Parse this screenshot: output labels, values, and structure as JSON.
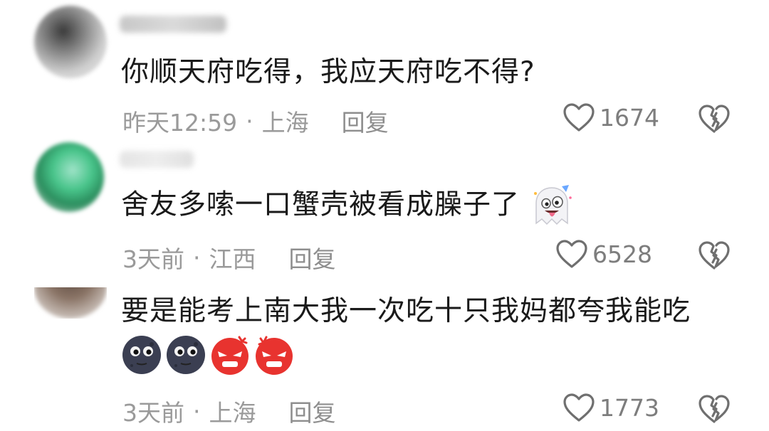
{
  "comments": [
    {
      "text": "你顺天府吃得，我应天府吃不得?",
      "time": "昨天12:59",
      "separator": "·",
      "location": "上海",
      "reply_label": "回复",
      "likes": "1674"
    },
    {
      "text": "舍友多嗦一口蟹壳被看成臊子了",
      "time": "3天前",
      "separator": "·",
      "location": "江西",
      "reply_label": "回复",
      "likes": "6528",
      "emoji": "ghost-tongue-emoji"
    },
    {
      "text": "要是能考上南大我一次吃十只我妈都夸我能吃",
      "time": "3天前",
      "separator": "·",
      "location": "上海",
      "reply_label": "回复",
      "likes": "1773",
      "emojis": [
        "dark-moon-emoji",
        "dark-moon-emoji",
        "angry-red-emoji",
        "angry-red-emoji"
      ]
    }
  ],
  "icons": {
    "like": "heart-outline-icon",
    "dislike": "broken-heart-icon"
  },
  "colors": {
    "meta_text": "#9a9a9a",
    "icon_stroke": "#6f6f6f"
  }
}
